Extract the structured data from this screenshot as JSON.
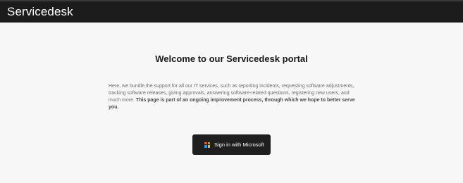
{
  "header": {
    "app_title": "Servicedesk"
  },
  "main": {
    "welcome_title": "Welcome to our Servicedesk portal",
    "intro_text": "Here, we bundle the support for all our IT services, such as reporting incidents, requesting software adjustments, tracking software releases, giving approvals, answering software-related questions, registering new users, and much more.",
    "intro_bold": "This page is part of an ongoing improvement process, through which we hope to better serve you.",
    "signin_button_label": "Sign in with Microsoft",
    "signin_icon": "microsoft-logo-icon"
  },
  "colors": {
    "topbar": "#1c1c1c",
    "background": "#f7f7f7",
    "button": "#1f1f1f"
  }
}
